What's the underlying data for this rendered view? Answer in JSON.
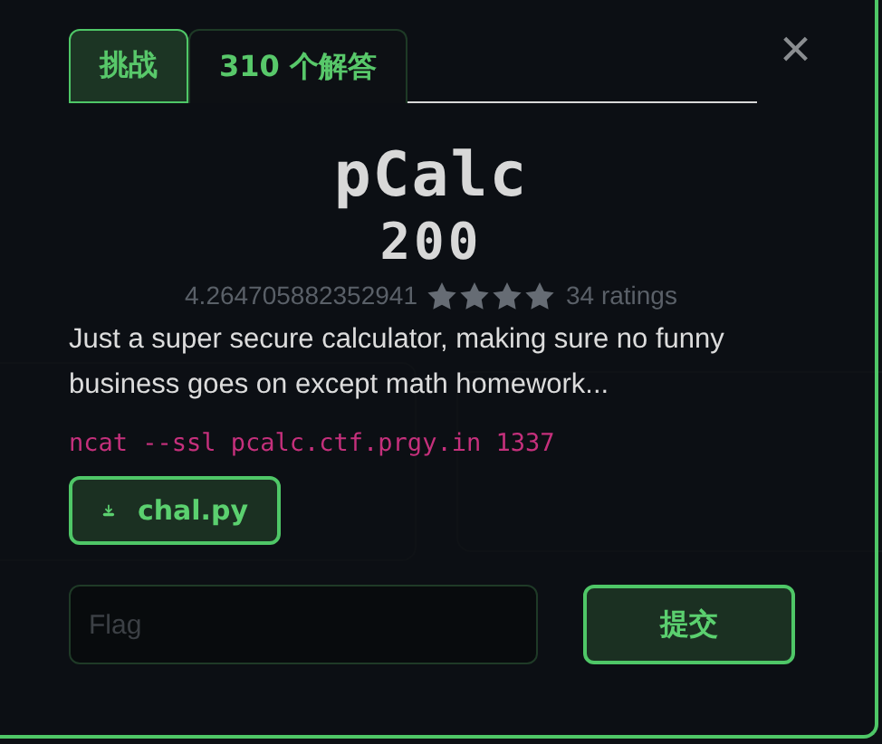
{
  "tabs": [
    {
      "label": "挑战",
      "selected": true
    },
    {
      "label": "310 个解答",
      "selected": false
    }
  ],
  "close": {
    "label": "×"
  },
  "challenge": {
    "name": "pCalc",
    "points": "200",
    "rating": "4.264705882352941",
    "stars": 4,
    "ratings_count": "34 ratings",
    "description": "Just a super secure calculator, making sure no funny business goes on except math homework...",
    "connection": "ncat --ssl pcalc.ctf.prgy.in 1337",
    "files": [
      {
        "name": "chal.py"
      }
    ]
  },
  "flag_input": {
    "placeholder": "Flag"
  },
  "submit": {
    "label": "提交"
  }
}
